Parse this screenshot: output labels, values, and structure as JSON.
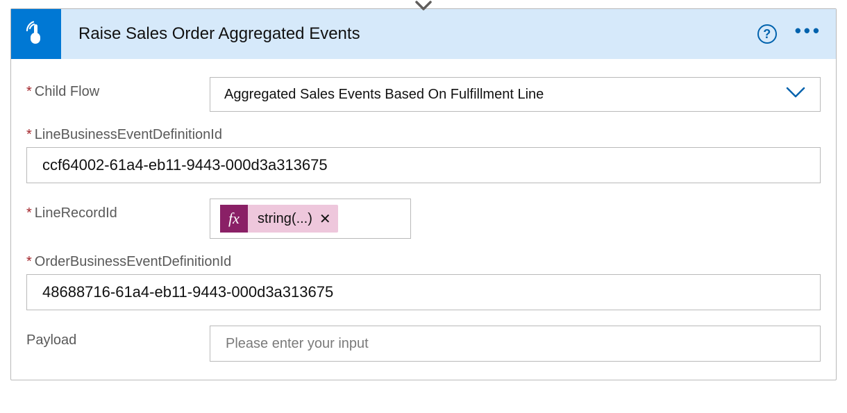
{
  "header": {
    "title": "Raise Sales Order Aggregated Events"
  },
  "fields": {
    "childFlow": {
      "label": "Child Flow",
      "value": "Aggregated Sales Events Based On Fulfillment Line"
    },
    "lineDef": {
      "label": "LineBusinessEventDefinitionId",
      "value": "ccf64002-61a4-eb11-9443-000d3a313675"
    },
    "lineRecord": {
      "label": "LineRecordId",
      "expr": "string(...)"
    },
    "orderDef": {
      "label": "OrderBusinessEventDefinitionId",
      "value": "48688716-61a4-eb11-9443-000d3a313675"
    },
    "payload": {
      "label": "Payload",
      "placeholder": "Please enter your input"
    }
  },
  "glyphs": {
    "fx": "fx",
    "x": "✕",
    "help": "?",
    "more": "•••"
  }
}
